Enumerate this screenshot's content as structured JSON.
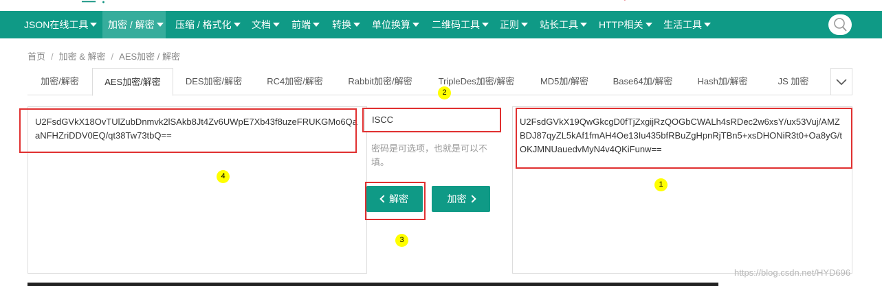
{
  "nav": {
    "items": [
      {
        "label": "JSON在线工具",
        "dropdown": true
      },
      {
        "label": "加密 / 解密",
        "dropdown": true,
        "active": true
      },
      {
        "label": "压缩 / 格式化",
        "dropdown": true
      },
      {
        "label": "文档",
        "dropdown": true
      },
      {
        "label": "前端",
        "dropdown": true
      },
      {
        "label": "转换",
        "dropdown": true
      },
      {
        "label": "单位换算",
        "dropdown": true
      },
      {
        "label": "二维码工具",
        "dropdown": true
      },
      {
        "label": "正则",
        "dropdown": true
      },
      {
        "label": "站长工具",
        "dropdown": true
      },
      {
        "label": "HTTP相关",
        "dropdown": true
      },
      {
        "label": "生活工具",
        "dropdown": true
      }
    ],
    "search_icon": "search-icon",
    "color": "#0f9a86"
  },
  "breadcrumb": [
    "首页",
    "加密 & 解密",
    "AES加密 / 解密"
  ],
  "tabs": [
    {
      "label": "加密/解密"
    },
    {
      "label": "AES加密/解密",
      "active": true
    },
    {
      "label": "DES加密/解密"
    },
    {
      "label": "RC4加密/解密"
    },
    {
      "label": "Rabbit加密/解密"
    },
    {
      "label": "TripleDes加密/解密"
    },
    {
      "label": "MD5加/解密"
    },
    {
      "label": "Base64加/解密"
    },
    {
      "label": "Hash加/解密"
    },
    {
      "label": "JS 加密"
    }
  ],
  "left_text": "U2FsdGVkX18OvTUlZubDnmvk2lSAkb8Jt4Zv6UWpE7Xb43f8uzeFRUKGMo6QaaNFHZriDDV0EQ/qt38Tw73tbQ==",
  "right_text": "U2FsdGVkX19QwGkcgD0fTjZxgijRzQOGbCWALh4sRDec2w6xsY/ux53Vuj/AMZBDJ87qyZL5kAf1fmAH4Oe13Iu435bfRBuZgHpnRjTBn5+xsDHONiR3t0+Oa8yG/tOKJMNUauedvMyN4v4QKiFunw==",
  "password": {
    "value": "ISCC",
    "hint": "密码是可选项，也就是可以不填。"
  },
  "buttons": {
    "decrypt": "解密",
    "encrypt": "加密"
  },
  "markers": [
    "1",
    "2",
    "3",
    "4"
  ],
  "watermark": "https://blog.csdn.net/HYD696",
  "colors": {
    "primary": "#0f9a86",
    "highlight": "#e03030",
    "marker": "#ffff00"
  }
}
